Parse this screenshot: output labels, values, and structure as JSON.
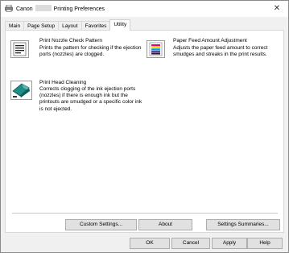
{
  "window": {
    "title_prefix": "Canon",
    "title_suffix": "Printing Preferences",
    "close_glyph": "✕"
  },
  "tabs": [
    {
      "label": "Main",
      "active": false
    },
    {
      "label": "Page Setup",
      "active": false
    },
    {
      "label": "Layout",
      "active": false
    },
    {
      "label": "Favorites",
      "active": false
    },
    {
      "label": "Utility",
      "active": true
    }
  ],
  "functions": {
    "nozzle_check": {
      "title": "Print Nozzle Check Pattern",
      "description": "Prints the pattern for checking if the ejection ports (nozzles) are clogged.",
      "icon": "nozzle-check-icon"
    },
    "paper_feed": {
      "title": "Paper Feed Amount Adjustment",
      "description": "Adjusts the paper feed amount to correct smudges and streaks in the print results.",
      "icon": "paper-feed-adjust-icon"
    },
    "head_cleaning": {
      "title": "Print Head Cleaning",
      "description": "Corrects clogging of the ink ejection ports (nozzles) if there is enough ink but the printouts are smudged or a specific color ink is not ejected.",
      "icon": "print-head-cleaning-icon"
    }
  },
  "panel_buttons": {
    "custom_settings": "Custom Settings...",
    "about": "About",
    "settings_summaries": "Settings Summaries..."
  },
  "dialog_buttons": {
    "ok": "OK",
    "cancel": "Cancel",
    "apply": "Apply",
    "help": "Help"
  },
  "colors": {
    "title_bar": "#ffffff",
    "window_bg": "#f0f0f0",
    "panel_bg": "#ffffff",
    "button_bg": "#e1e1e1",
    "cleaning_icon_teal": "#1f8c87"
  }
}
